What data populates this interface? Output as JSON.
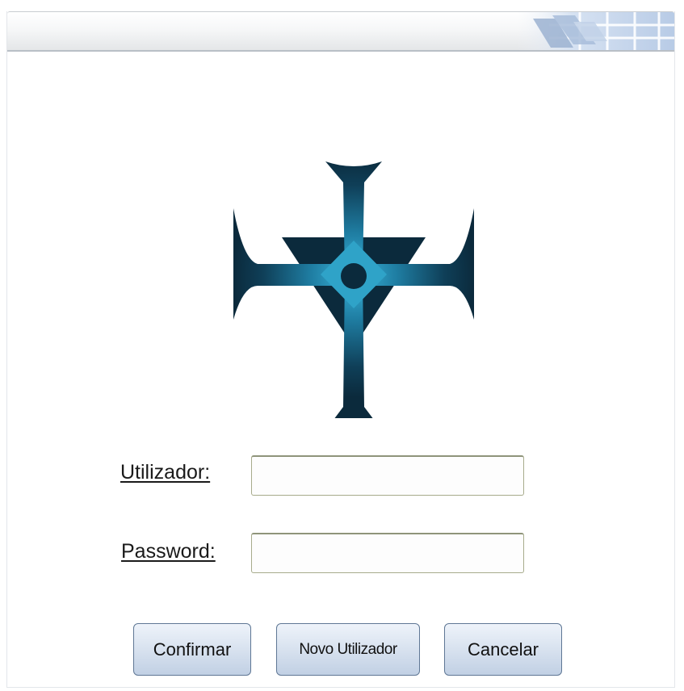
{
  "login_form": {
    "username_label": "Utilizador:",
    "username_value": "",
    "password_label": "Password:",
    "password_value": ""
  },
  "buttons": {
    "confirm_label": "Confirmar",
    "new_user_label": "Novo Utilizador",
    "cancel_label": "Cancelar"
  },
  "icons": {
    "logo": "cross-emblem-logo",
    "title_decoration": "grid-pattern-decoration"
  },
  "colors": {
    "logo_dark": "#0b2a3c",
    "logo_light": "#2fa3c8",
    "button_border": "#5f7795",
    "button_fill_top": "#eef3fa",
    "button_fill_bottom": "#c1d0e4",
    "field_border": "#a7ab8c"
  }
}
